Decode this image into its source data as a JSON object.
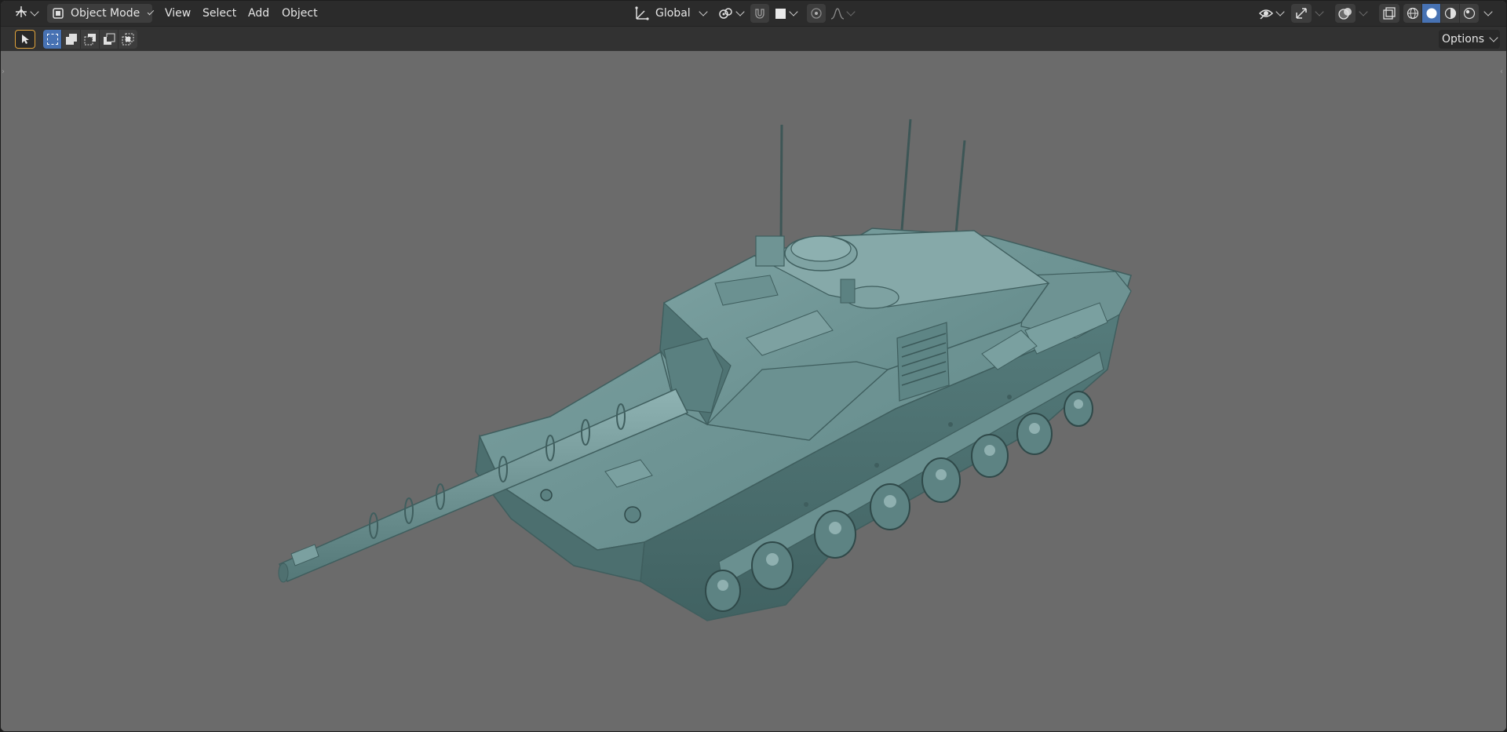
{
  "header": {
    "mode_label": "Object Mode",
    "menus": [
      "View",
      "Select",
      "Add",
      "Object"
    ],
    "orientation_label": "Global"
  },
  "tool_header": {
    "options_label": "Options"
  },
  "icons": {
    "editor_type": "object-data-transform-icon",
    "mode": "object-mode-icon",
    "transform_orientation": "orientation-gizmo-icon",
    "pivot": "pivot-link-icon",
    "snap": "snap-magnet-icon",
    "proportional": "proportional-edit-icon",
    "falloff": "falloff-curve-icon",
    "visibility": "eye-visibility-icon",
    "gizmo": "gizmo-arrows-icon",
    "overlay": "overlay-circles-icon",
    "xray": "xray-toggle-icon",
    "shading_wire": "wireframe-shading-icon",
    "shading_solid": "solid-shading-icon",
    "shading_material": "material-shading-icon",
    "shading_rendered": "rendered-shading-icon",
    "select_tool": "select-cursor-icon"
  },
  "colors": {
    "viewport_bg": "#6b6b6b",
    "header_bg": "#2b2b2b",
    "active_blue": "#4772b3",
    "tank_body": "#5f8787"
  }
}
